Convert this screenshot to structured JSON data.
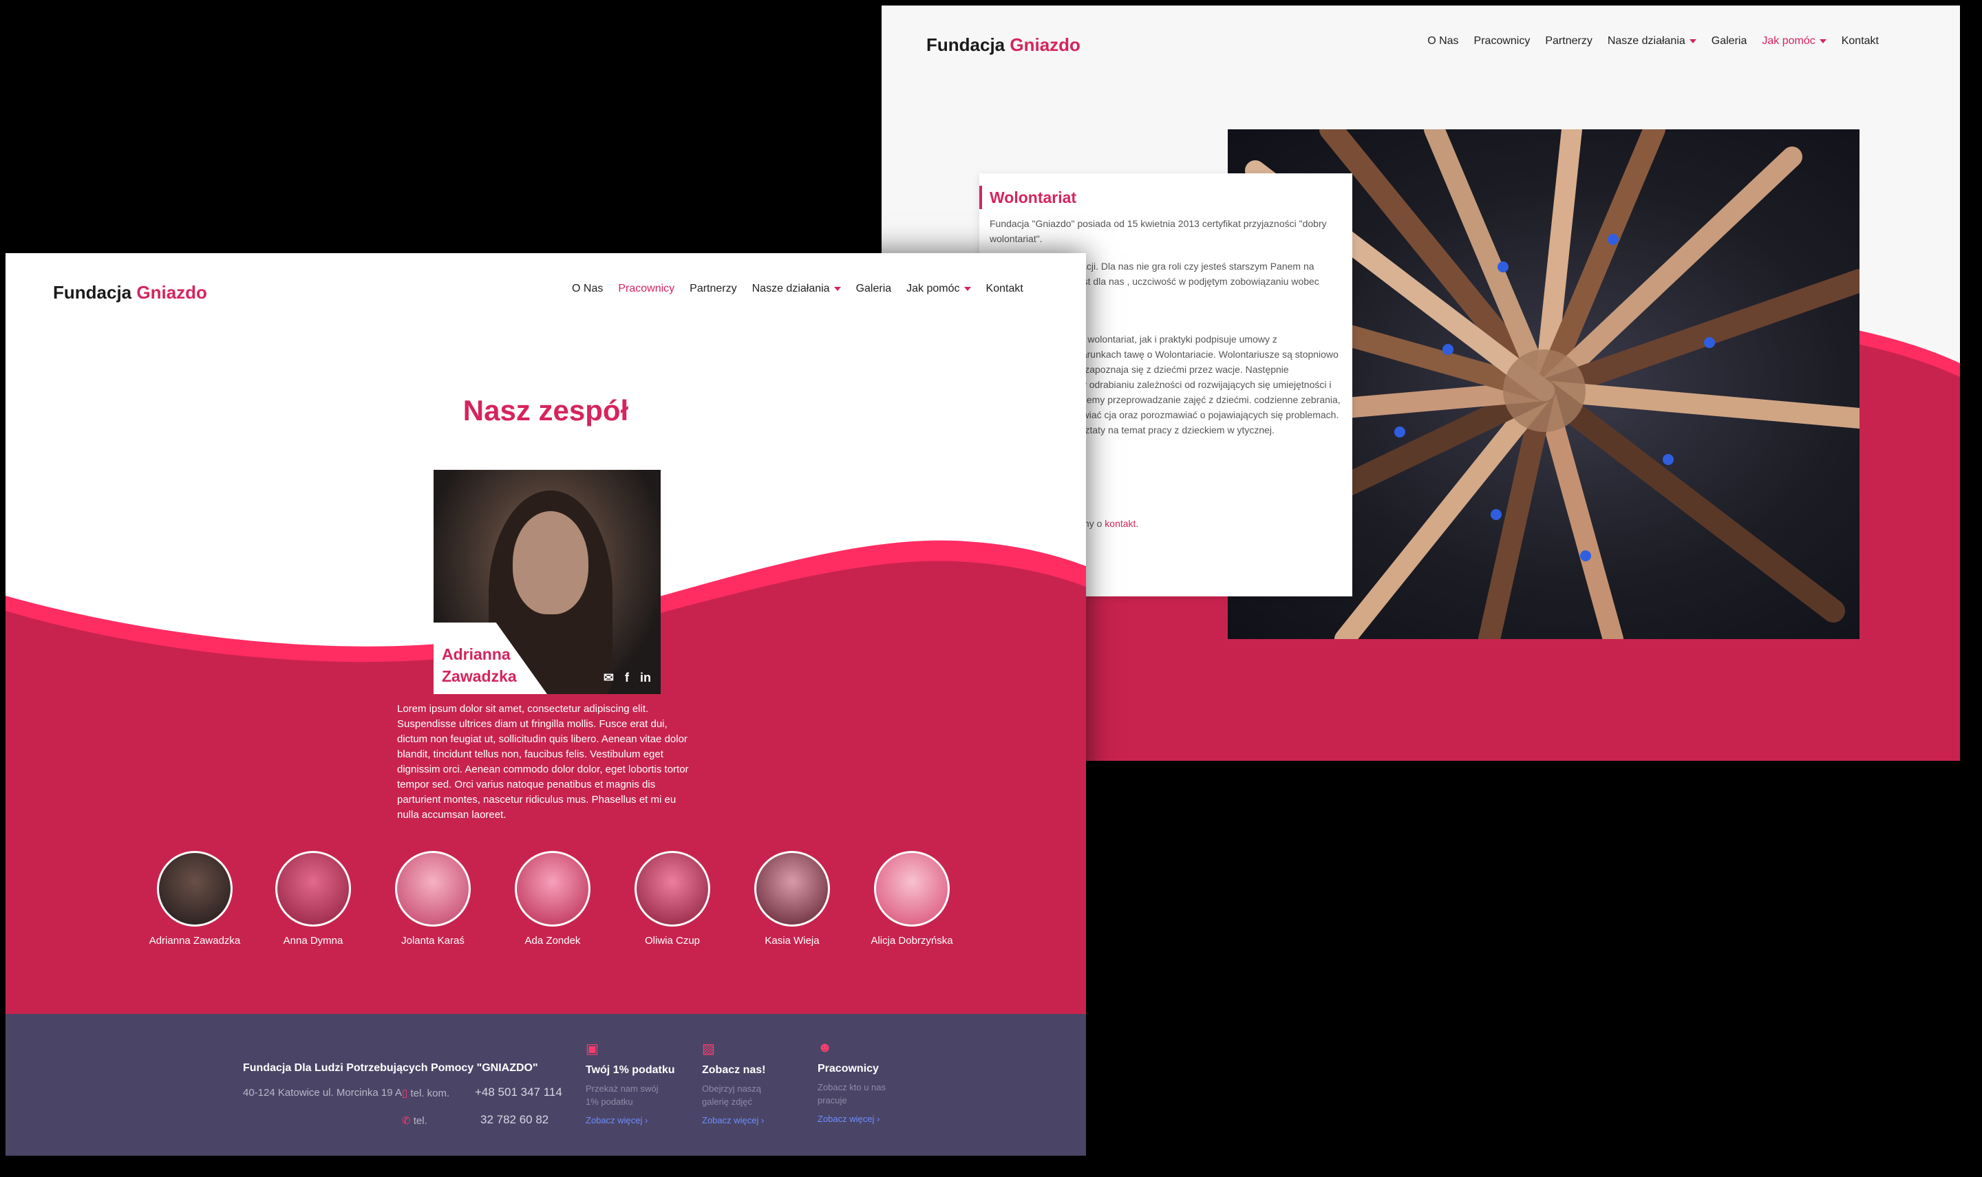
{
  "colors": {
    "accent": "#d6245c",
    "wave": "#c8234e",
    "wave_top": "#ff2d62",
    "footer": "#4a4566"
  },
  "back": {
    "logo_a": "Fundacja",
    "logo_b": "Gniazdo",
    "nav": [
      "O Nas",
      "Pracownicy",
      "Partnerzy",
      "Nasze działania",
      "Galeria",
      "Jak pomóc",
      "Kontakt"
    ],
    "active_nav": "Jak pomóc",
    "card": {
      "title": "Wolontariat",
      "p1": "Fundacja \"Gniazdo\" posiada od 15 kwietnia 2013 certyfikat przyjazności \"dobry wolontariat\".",
      "p2": "ntariat w naszej Fundacji. Dla nas nie gra roli czy jesteś starszym Panem na emeryturze! Ważne jest dla nas , uczciwość w podjętym zobowiązaniu wobec dzieciaków",
      "p3": "żna odbywać zarówno wolontariat, jak i praktyki podpisuje umowy z wolontariuszami na warunkach tawę o Wolontariacie. Wolontariusze są stopniowo świetlicy. Początkowo zapoznaja się z dziećmi przez wacje. Następnie proponujemy pomoc w odrabianiu zależności od rozwijających się umiejętności i długości riatu proponujemy przeprowadzanie zajęć z dziećmi. codzienne zebrania, na których mogą omawiać cja oraz porozmawiać o pojawiających się problemach. W wają się także warsztaty na temat pracy z dzieckiem w ytycznej.",
      "p4_text": "e wolontariatem prosimy o ",
      "p4_link": "kontakt",
      "p4_end": "."
    }
  },
  "front": {
    "logo_a": "Fundacja",
    "logo_b": "Gniazdo",
    "nav": [
      "O Nas",
      "Pracownicy",
      "Partnerzy",
      "Nasze działania",
      "Galeria",
      "Jak pomóc",
      "Kontakt"
    ],
    "active_nav": "Pracownicy",
    "heading": "Nasz zespół",
    "featured": {
      "name": "Adrianna Zawadzka",
      "bio": "Lorem ipsum dolor sit amet, consectetur adipiscing elit. Suspendisse ultrices diam ut fringilla mollis. Fusce erat dui, dictum non feugiat ut, sollicitudin quis libero. Aenean vitae dolor blandit, tincidunt tellus non, faucibus felis. Vestibulum eget dignissim orci. Aenean commodo dolor dolor, eget lobortis tortor tempor sed. Orci varius natoque penatibus et magnis dis parturient montes, nascetur ridiculus mus. Phasellus et mi eu nulla accumsan laoreet.",
      "icons": [
        "envelope-icon",
        "facebook-icon",
        "linkedin-icon"
      ]
    },
    "team": [
      "Adrianna Zawadzka",
      "Anna Dymna",
      "Jolanta Karaś",
      "Ada Zondek",
      "Oliwia Czup",
      "Kasia Wieja",
      "Alicja Dobrzyńska"
    ],
    "footer": {
      "org": "Fundacja Dla Ludzi Potrzebujących Pomocy \"GNIAZDO\"",
      "address": "40-124 Katowice ul. Morcinka 19 A",
      "phone_kom_label": "tel. kom.",
      "phone_kom": "+48 501 347 114",
      "phone_label": "tel.",
      "phone": "32 782 60 82",
      "cols": [
        {
          "icon": "money-icon",
          "title": "Twój 1% podatku",
          "desc": "Przekaż nam swój 1% podatku",
          "more": "Zobacz więcej"
        },
        {
          "icon": "image-icon",
          "title": "Zobacz nas!",
          "desc": "Obejrzyj naszą galerię zdjęć",
          "more": "Zobacz więcej"
        },
        {
          "icon": "smile-icon",
          "title": "Pracownicy",
          "desc": "Zobacz kto u nas pracuje",
          "more": "Zobacz więcej"
        }
      ]
    }
  }
}
